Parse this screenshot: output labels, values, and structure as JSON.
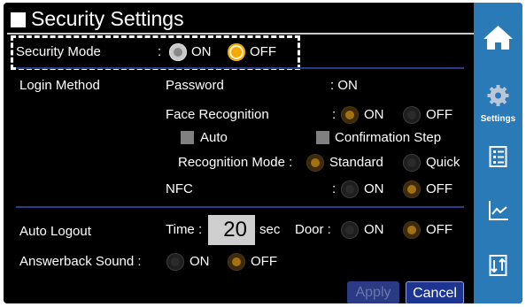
{
  "header": {
    "title": "Security Settings"
  },
  "security_mode": {
    "label": "Security Mode",
    "colon": ":",
    "on_label": "ON",
    "off_label": "OFF",
    "selected": "OFF"
  },
  "login_method": {
    "label": "Login Method",
    "password": {
      "label": "Password",
      "value": ": ON"
    },
    "face_recognition": {
      "label": "Face Recognition",
      "colon": ":",
      "on_label": "ON",
      "off_label": "OFF",
      "selected": "ON",
      "auto_label": "Auto",
      "auto_checked": false,
      "confirmation_label": "Confirmation Step",
      "confirmation_checked": false,
      "recognition_mode_label": "Recognition Mode :",
      "standard_label": "Standard",
      "quick_label": "Quick",
      "recognition_mode_selected": "Standard"
    },
    "nfc": {
      "label": "NFC",
      "colon": ":",
      "on_label": "ON",
      "off_label": "OFF",
      "selected": "OFF"
    }
  },
  "auto_logout": {
    "label": "Auto Logout",
    "time_label": "Time :",
    "time_value": "20",
    "time_unit": "sec",
    "door_label": "Door :",
    "on_label": "ON",
    "off_label": "OFF",
    "door_selected": "OFF"
  },
  "answerback": {
    "label": "Answerback Sound :",
    "on_label": "ON",
    "off_label": "OFF",
    "selected": "OFF"
  },
  "buttons": {
    "apply": "Apply",
    "cancel": "Cancel"
  },
  "sidebar": {
    "items": [
      {
        "icon": "home-icon"
      },
      {
        "icon": "gear-icon",
        "label": "Settings",
        "active": true
      },
      {
        "icon": "list-icon"
      },
      {
        "icon": "chart-icon"
      },
      {
        "icon": "transfer-icon"
      }
    ]
  },
  "colors": {
    "background": "#000000",
    "sidebar": "#2a7ab8",
    "accent": "#f5a800",
    "separator": "#2a3b8c",
    "button_primary": "#1d3591"
  }
}
